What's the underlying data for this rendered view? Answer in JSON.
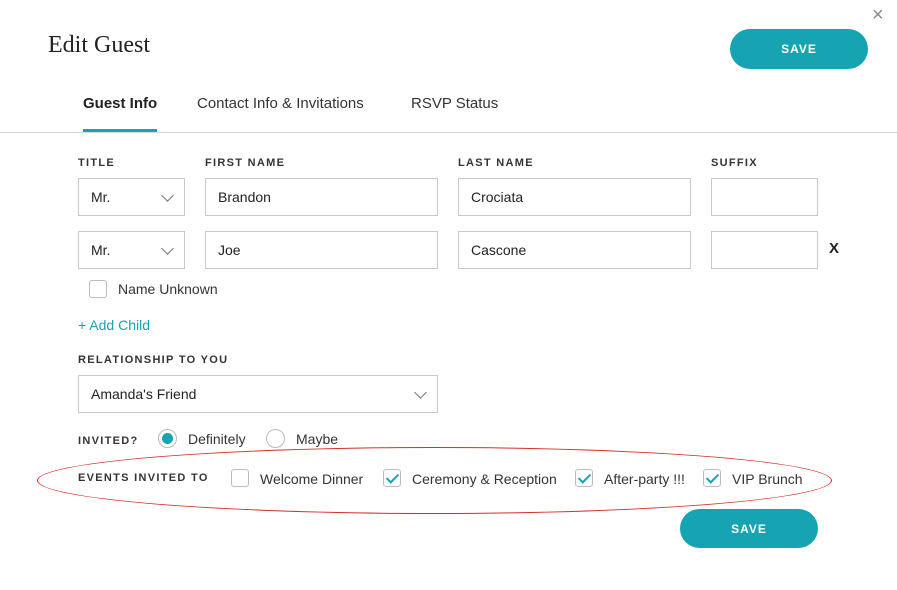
{
  "header": {
    "title": "Edit Guest",
    "save_label": "SAVE",
    "close_glyph": "×"
  },
  "tabs": [
    {
      "label": "Guest Info",
      "active": true
    },
    {
      "label": "Contact Info & Invitations",
      "active": false
    },
    {
      "label": "RSVP Status",
      "active": false
    }
  ],
  "columns": {
    "title": "TITLE",
    "first_name": "FIRST NAME",
    "last_name": "LAST NAME",
    "suffix": "SUFFIX"
  },
  "guests": [
    {
      "title": "Mr.",
      "first_name": "Brandon",
      "last_name": "Crociata",
      "suffix": ""
    },
    {
      "title": "Mr.",
      "first_name": "Joe",
      "last_name": "Cascone",
      "suffix": "",
      "remove_label": "X"
    }
  ],
  "name_unknown_label": "Name Unknown",
  "add_child_label": "+ Add Child",
  "relationship": {
    "label": "RELATIONSHIP TO YOU",
    "value": "Amanda's Friend"
  },
  "invited": {
    "label": "INVITED?",
    "options": [
      {
        "label": "Definitely",
        "selected": true
      },
      {
        "label": "Maybe",
        "selected": false
      }
    ]
  },
  "events": {
    "label": "EVENTS INVITED TO",
    "items": [
      {
        "label": "Welcome Dinner",
        "checked": false
      },
      {
        "label": "Ceremony & Reception",
        "checked": true
      },
      {
        "label": "After-party !!!",
        "checked": true
      },
      {
        "label": "VIP Brunch",
        "checked": true
      }
    ]
  },
  "footer": {
    "save_label": "SAVE"
  },
  "colors": {
    "accent": "#16a3b2",
    "annotation": "#d0302a"
  }
}
